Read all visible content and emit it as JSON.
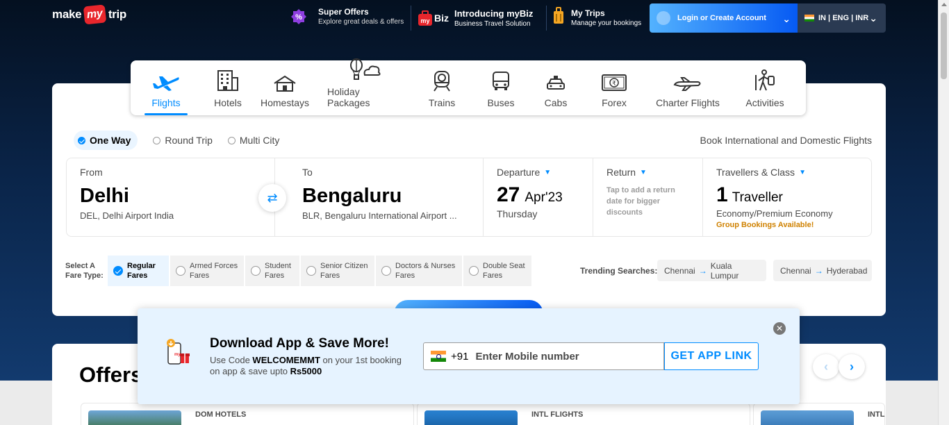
{
  "header": {
    "logo_make": "make",
    "logo_my": "my",
    "logo_trip": "trip",
    "super_offers": {
      "title": "Super Offers",
      "subtitle": "Explore great deals & offers"
    },
    "mybiz": {
      "badge": "Biz",
      "title": "Introducing myBiz",
      "subtitle": "Business Travel Solution"
    },
    "my_trips": {
      "title": "My Trips",
      "subtitle": "Manage your bookings"
    },
    "login_label": "Login or Create Account",
    "locale_label": "IN | ENG | INR"
  },
  "nav": [
    {
      "label": "Flights",
      "icon": "flight-icon"
    },
    {
      "label": "Hotels",
      "icon": "hotel-icon"
    },
    {
      "label": "Homestays",
      "icon": "homestay-icon"
    },
    {
      "label": "Holiday Packages",
      "icon": "holiday-icon"
    },
    {
      "label": "Trains",
      "icon": "train-icon"
    },
    {
      "label": "Buses",
      "icon": "bus-icon"
    },
    {
      "label": "Cabs",
      "icon": "cab-icon"
    },
    {
      "label": "Forex",
      "icon": "forex-icon"
    },
    {
      "label": "Charter Flights",
      "icon": "charter-icon"
    },
    {
      "label": "Activities",
      "icon": "activities-icon"
    }
  ],
  "trip_types": [
    "One Way",
    "Round Trip",
    "Multi City"
  ],
  "book_intl": "Book International and Domestic Flights",
  "search": {
    "from_label": "From",
    "from_city": "Delhi",
    "from_sub": "DEL, Delhi Airport India",
    "to_label": "To",
    "to_city": "Bengaluru",
    "to_sub": "BLR, Bengaluru International Airport ...",
    "dep_label": "Departure",
    "dep_day": "27",
    "dep_month": "Apr'23",
    "dep_weekday": "Thursday",
    "ret_label": "Return",
    "ret_hint": "Tap to add a return date for bigger discounts",
    "trav_label": "Travellers & Class",
    "trav_count": "1",
    "trav_word": "Traveller",
    "trav_class": "Economy/Premium Economy",
    "group_link": "Group Bookings Available!"
  },
  "fare_type_label_1": "Select A",
  "fare_type_label_2": "Fare Type:",
  "fares": [
    {
      "l1": "Regular",
      "l2": "Fares"
    },
    {
      "l1": "Armed Forces",
      "l2": "Fares"
    },
    {
      "l1": "Student",
      "l2": "Fares"
    },
    {
      "l1": "Senior Citizen",
      "l2": "Fares"
    },
    {
      "l1": "Doctors & Nurses",
      "l2": "Fares"
    },
    {
      "l1": "Double Seat",
      "l2": "Fares"
    }
  ],
  "trending_label": "Trending Searches:",
  "trending": [
    {
      "from": "Chennai",
      "to": "Kuala Lumpur"
    },
    {
      "from": "Chennai",
      "to": "Hyderabad"
    }
  ],
  "offers": {
    "title": "Offers",
    "categories": [
      "DOM HOTELS",
      "INTL FLIGHTS",
      "INTL"
    ]
  },
  "app_popup": {
    "title": "Download App & Save More!",
    "sub_prefix": "Use Code ",
    "code": "WELCOMEMMT",
    "sub_mid": " on your 1st booking on app & save upto ",
    "amount": "Rs5000",
    "country_code": "+91",
    "mobile_placeholder": "Enter Mobile number",
    "cta": "GET APP LINK",
    "close_symbol": "✕"
  },
  "colors": {
    "accent": "#008cff",
    "brand_red": "#e8262c",
    "group_orange": "#cf8100"
  }
}
